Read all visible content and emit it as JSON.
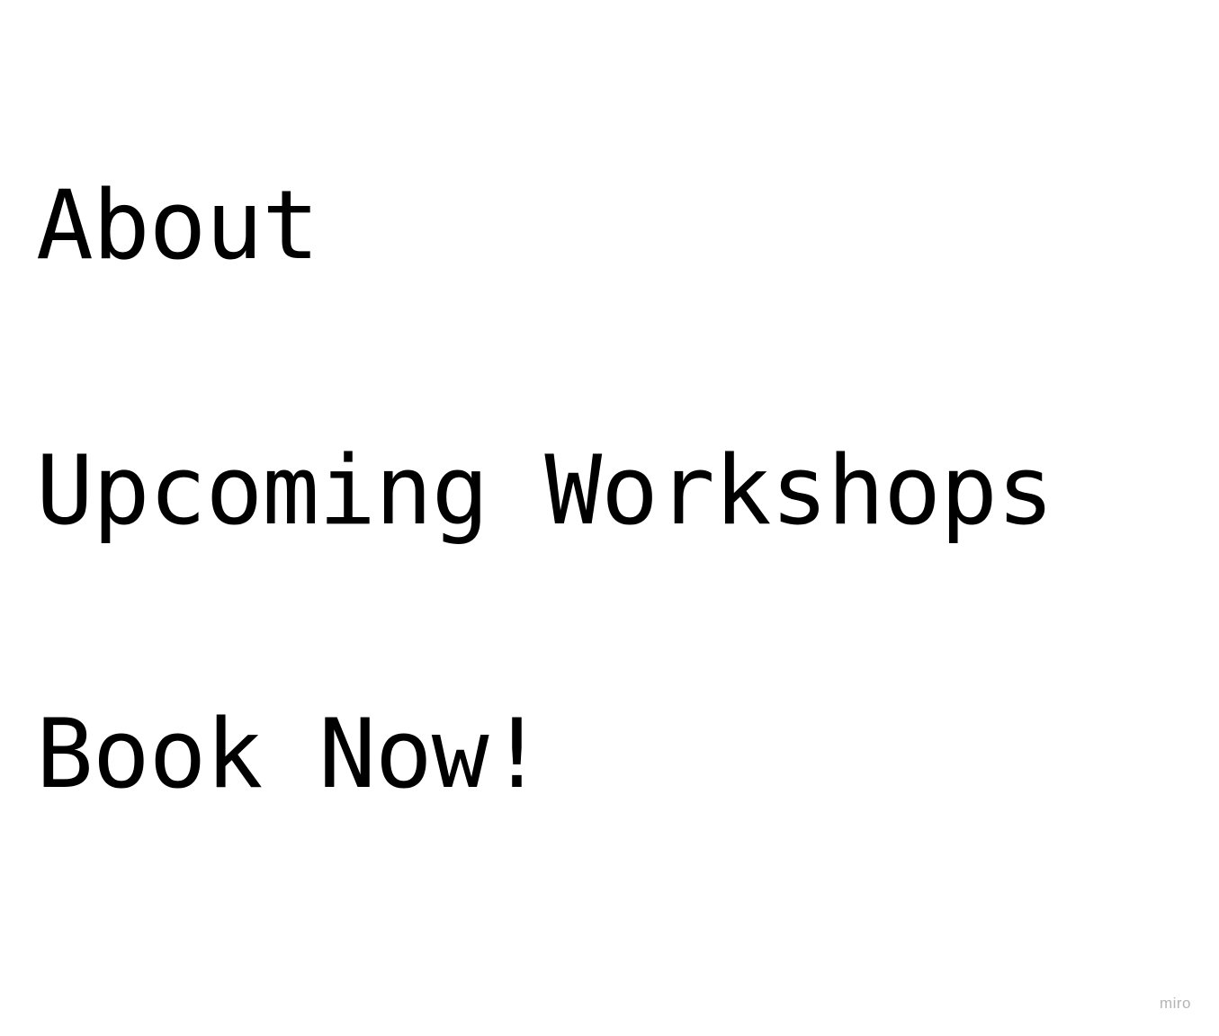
{
  "nav": {
    "items": [
      {
        "label": "About"
      },
      {
        "label": "Upcoming Workshops"
      },
      {
        "label": "Book Now!"
      }
    ]
  },
  "watermark": {
    "text": "miro"
  },
  "colors": {
    "background": "#ffffff",
    "text": "#000000",
    "watermark": "#b4b4b4"
  }
}
